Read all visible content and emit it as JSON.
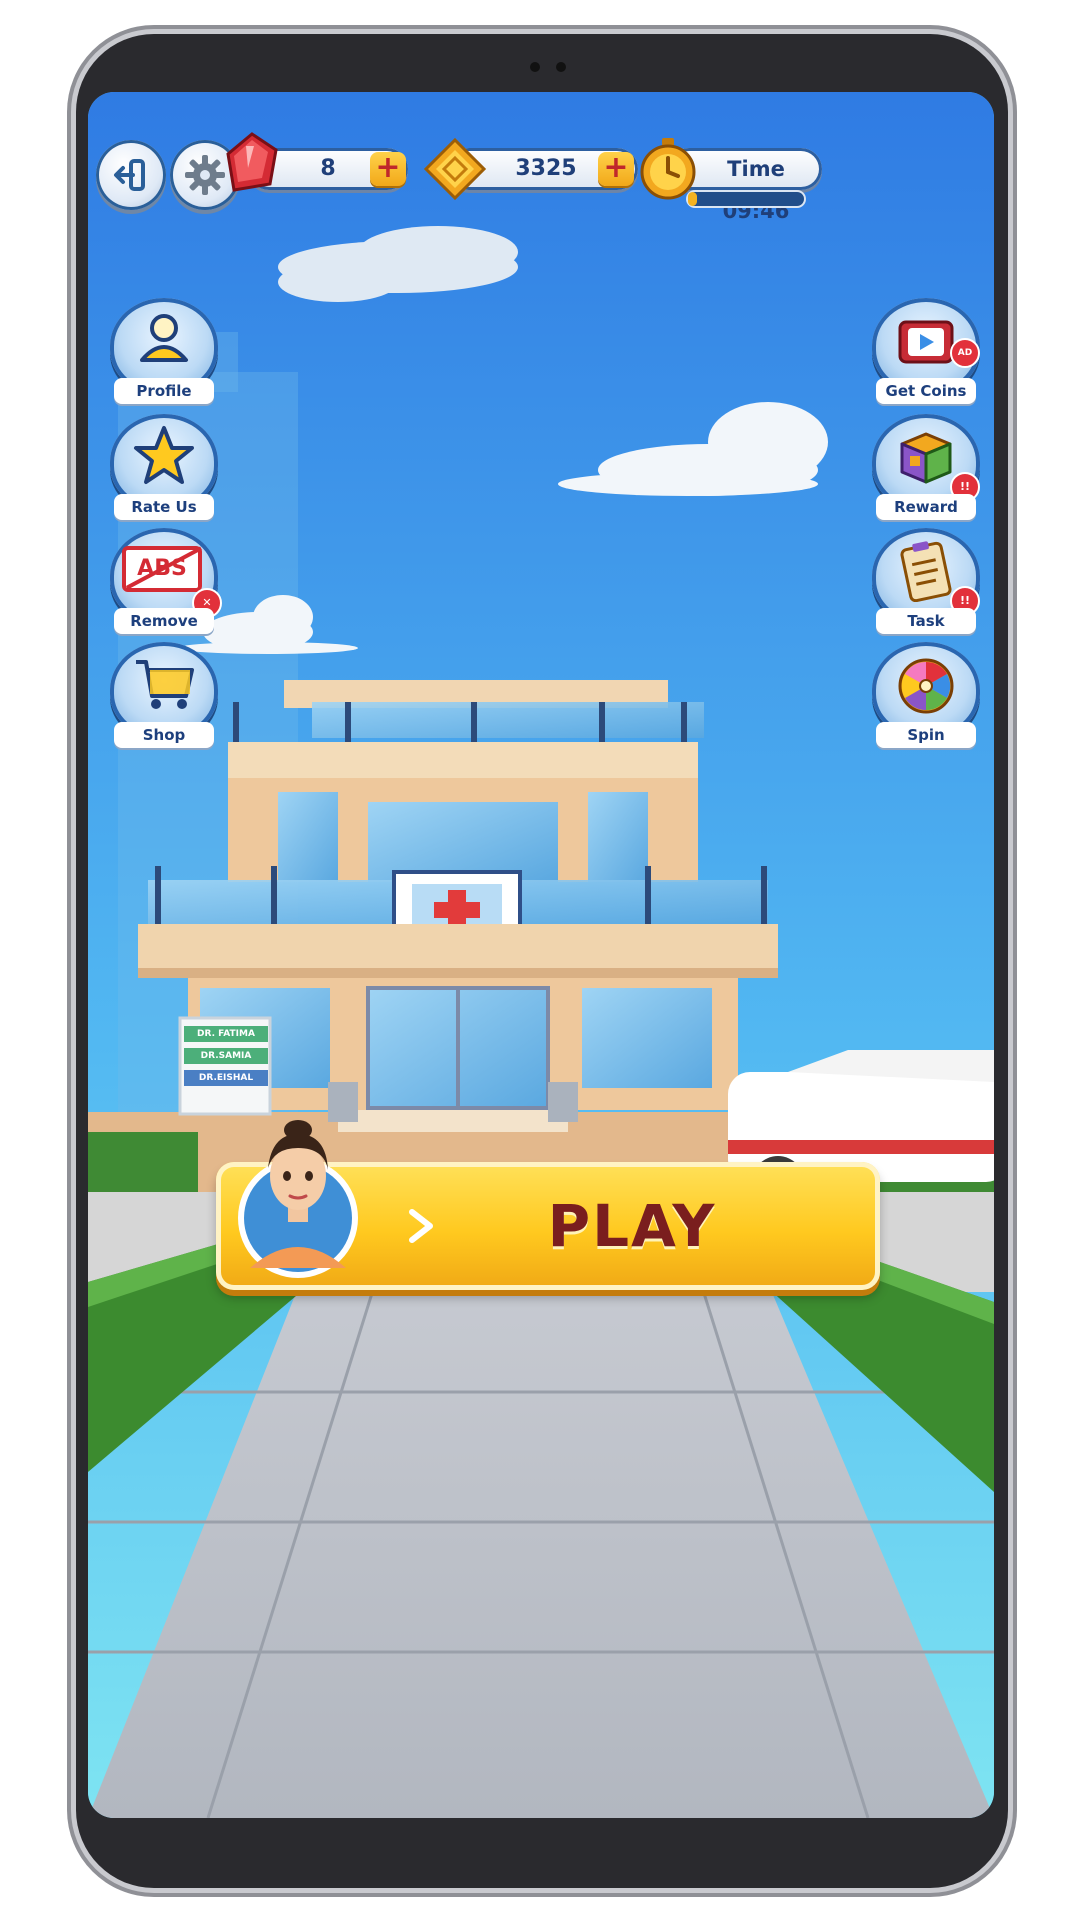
{
  "hud": {
    "gems": "8",
    "coins": "3325",
    "timer": "Time 09:46",
    "plus": "+"
  },
  "left_menu": [
    {
      "label": "Profile"
    },
    {
      "label": "Rate Us"
    },
    {
      "label": "Remove",
      "icon_text": "ABS"
    },
    {
      "label": "Shop"
    }
  ],
  "right_menu": [
    {
      "label": "Get Coins",
      "badge": "AD"
    },
    {
      "label": "Reward",
      "badge": "!!"
    },
    {
      "label": "Task",
      "badge": "!!"
    },
    {
      "label": "Spin"
    }
  ],
  "hospital": {
    "doctors": [
      "DR. FATIMA",
      "DR.SAMIA",
      "DR.EISHAL"
    ]
  },
  "play": {
    "label": "PLAY"
  },
  "colors": {
    "sky_top": "#2f7be3",
    "sky_bottom": "#67d9f0",
    "play_yellow": "#ffc91f",
    "play_text": "#7a1e1e",
    "hud_blue": "#1f3f79",
    "cross_red": "#e23b3b"
  },
  "icons": [
    "exit-icon",
    "gear-icon",
    "gem-icon",
    "coin-icon",
    "stopwatch-icon",
    "profile-icon",
    "star-icon",
    "no-ads-icon",
    "cart-icon",
    "video-icon",
    "gift-box-icon",
    "clipboard-icon",
    "wheel-icon",
    "chevron-right-icon"
  ]
}
